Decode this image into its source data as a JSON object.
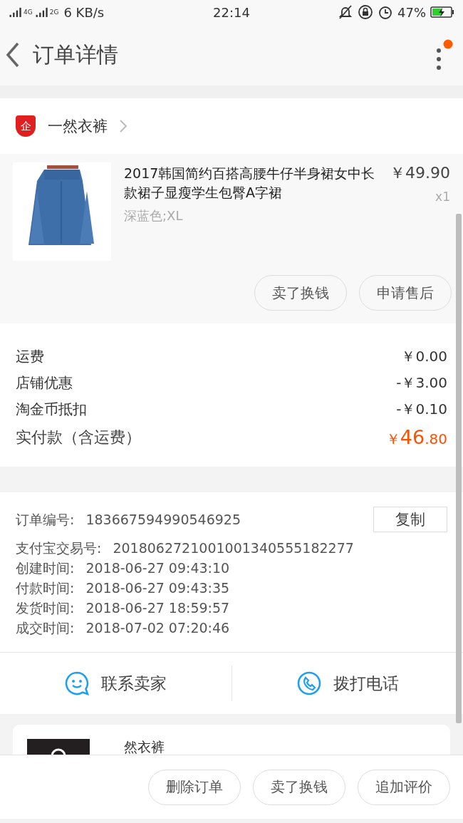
{
  "status_bar": {
    "network_1": "4G",
    "network_2": "2G",
    "speed": "6 KB/s",
    "time": "22:14",
    "battery": "47%"
  },
  "header": {
    "title": "订单详情",
    "has_notification": true
  },
  "store": {
    "badge": "企",
    "name": "一然衣裤"
  },
  "product": {
    "title": "2017韩国简约百搭高腰牛仔半身裙女中长款裙子显瘦学生包臀A字裙",
    "variant": "深蓝色;XL",
    "price": "￥49.90",
    "quantity": "x1",
    "actions": [
      "卖了换钱",
      "申请售后"
    ]
  },
  "costs": [
    {
      "label": "运费",
      "value": "￥0.00"
    },
    {
      "label": "店铺优惠",
      "value": "-￥3.00"
    },
    {
      "label": "淘金币抵扣",
      "value": "-￥0.10"
    }
  ],
  "total": {
    "label": "实付款（含运费）",
    "currency": "￥",
    "integer": "46",
    "decimal": ".80"
  },
  "info": [
    {
      "label": "订单编号:",
      "value": "183667594990546925",
      "copy": "复制"
    },
    {
      "label": "支付宝交易号:",
      "value": "2018062721001001340555182277"
    },
    {
      "label": "创建时间:",
      "value": "2018-06-27 09:43:10"
    },
    {
      "label": "付款时间:",
      "value": "2018-06-27 09:43:35"
    },
    {
      "label": "发货时间:",
      "value": "2018-06-27 18:59:57"
    },
    {
      "label": "成交时间:",
      "value": "2018-07-02 07:20:46"
    }
  ],
  "contact": [
    {
      "label": "联系卖家",
      "kind": "chat"
    },
    {
      "label": "拨打电话",
      "kind": "phone"
    }
  ],
  "recommendation": {
    "name": "然衣裤"
  },
  "bottom_actions": [
    "删除订单",
    "卖了换钱",
    "追加评价"
  ]
}
